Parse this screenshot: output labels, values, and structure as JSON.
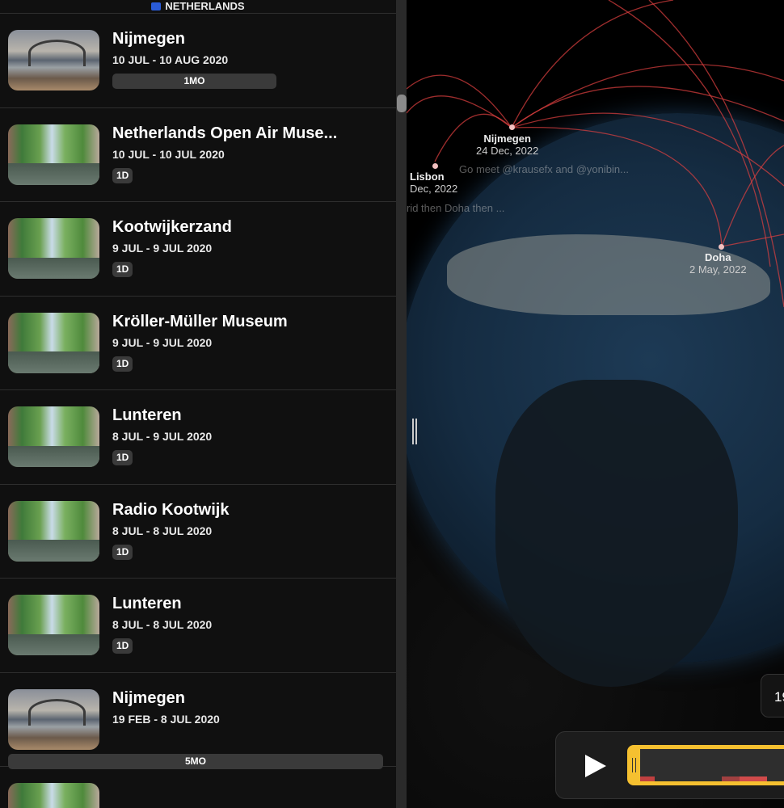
{
  "list": {
    "section_header": "NETHERLANDS",
    "items": [
      {
        "title": "Nijmegen",
        "date": "10 JUL - 10 AUG 2020",
        "duration": "1MO",
        "thumb": "bridge"
      },
      {
        "title": "Netherlands Open Air Muse...",
        "date": "10 JUL - 10 JUL 2020",
        "duration": "1D",
        "thumb": "canal"
      },
      {
        "title": "Kootwijkerzand",
        "date": "9 JUL - 9 JUL 2020",
        "duration": "1D",
        "thumb": "canal"
      },
      {
        "title": "Kröller-Müller Museum",
        "date": "9 JUL - 9 JUL 2020",
        "duration": "1D",
        "thumb": "canal"
      },
      {
        "title": "Lunteren",
        "date": "8 JUL - 9 JUL 2020",
        "duration": "1D",
        "thumb": "canal"
      },
      {
        "title": "Radio Kootwijk",
        "date": "8 JUL - 8 JUL 2020",
        "duration": "1D",
        "thumb": "canal"
      },
      {
        "title": "Lunteren",
        "date": "8 JUL - 8 JUL 2020",
        "duration": "1D",
        "thumb": "canal"
      },
      {
        "title": "Nijmegen",
        "date": "19 FEB - 8 JUL 2020",
        "duration": "5MO",
        "thumb": "bridge"
      }
    ]
  },
  "map": {
    "cities": [
      {
        "name": "Nijmegen",
        "date": "24 Dec, 2022"
      },
      {
        "name": "Lisbon",
        "date": "Dec, 2022"
      },
      {
        "name": "Doha",
        "date": "2 May, 2022"
      }
    ],
    "notes": [
      "Go meet @krausefx and @yonibin...",
      "rid then Doha then ..."
    ],
    "arc_color": "#e04040"
  },
  "player": {
    "date_partial": "19",
    "play_icon": "play-icon",
    "accent": "#f5c030"
  }
}
